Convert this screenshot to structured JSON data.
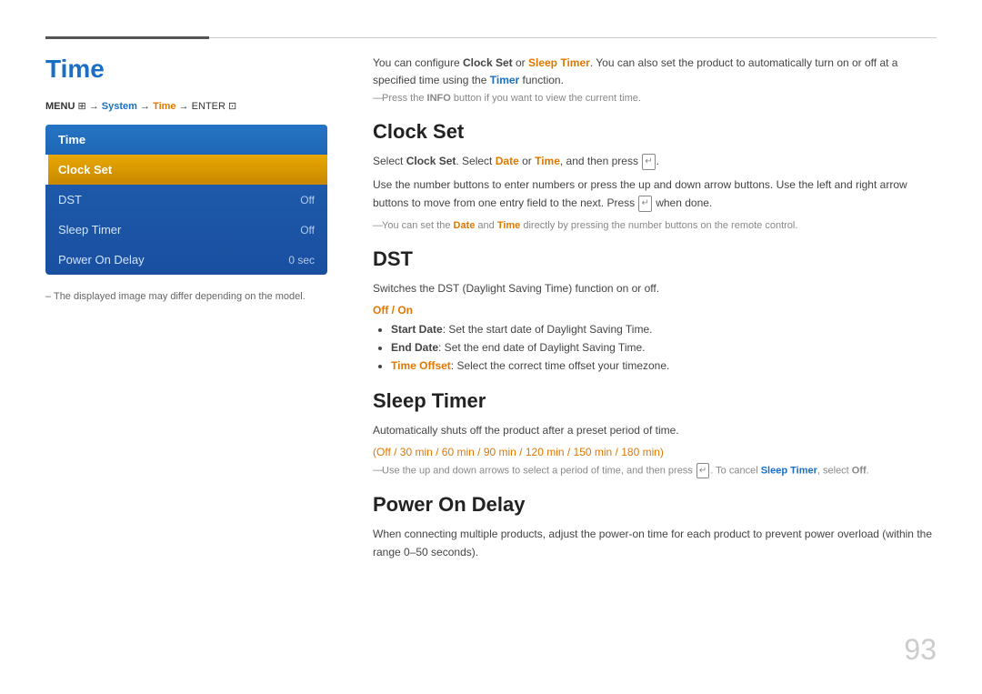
{
  "topbar": {},
  "left": {
    "title": "Time",
    "menu_path_prefix": "MENU",
    "menu_path": "→ System → Time → ENTER",
    "menu_header": "Time",
    "menu_items": [
      {
        "label": "Clock Set",
        "value": "",
        "selected": true
      },
      {
        "label": "DST",
        "value": "Off",
        "selected": false
      },
      {
        "label": "Sleep Timer",
        "value": "Off",
        "selected": false
      },
      {
        "label": "Power On Delay",
        "value": "0 sec",
        "selected": false
      }
    ],
    "note": "–  The displayed image may differ depending on the model."
  },
  "right": {
    "intro_line1_prefix": "You can configure ",
    "intro_clock_set": "Clock Set",
    "intro_line1_mid": " or ",
    "intro_sleep_timer": "Sleep Timer",
    "intro_line1_suffix": ". You can also set the product to automatically turn on or off at a specified time using the ",
    "intro_timer": "Timer",
    "intro_line1_end": " function.",
    "press_note": "Press the INFO button if you want to view the current time.",
    "sections": [
      {
        "id": "clock-set",
        "title": "Clock Set",
        "body_parts": [
          {
            "text": "Select ",
            "style": "normal"
          },
          {
            "text": "Clock Set",
            "style": "bold"
          },
          {
            "text": ". Select ",
            "style": "normal"
          },
          {
            "text": "Date",
            "style": "orange"
          },
          {
            "text": " or ",
            "style": "normal"
          },
          {
            "text": "Time",
            "style": "orange"
          },
          {
            "text": ", and then press ",
            "style": "normal"
          },
          {
            "text": "[E]",
            "style": "enter"
          },
          {
            "text": ".",
            "style": "normal"
          }
        ],
        "body2": "Use the number buttons to enter numbers or press the up and down arrow buttons. Use the left and right arrow buttons to move from one entry field to the next. Press [E] when done.",
        "note": "You can set the Date and Time directly by pressing the number buttons on the remote control.",
        "has_note": true
      },
      {
        "id": "dst",
        "title": "DST",
        "body1": "Switches the DST (Daylight Saving Time) function on or off.",
        "off_on": "Off / On",
        "bullets": [
          {
            "label": "Start Date",
            "text": ": Set the start date of Daylight Saving Time."
          },
          {
            "label": "End Date",
            "text": ": Set the end date of Daylight Saving Time."
          },
          {
            "label": "Time Offset",
            "text": ": Select the correct time offset your timezone."
          }
        ]
      },
      {
        "id": "sleep-timer",
        "title": "Sleep Timer",
        "body1": "Automatically shuts off the product after a preset period of time.",
        "options": "(Off / 30 min / 60 min / 90 min / 120 min / 150 min / 180 min)",
        "note": "Use the up and down arrows to select a period of time, and then press [E]. To cancel Sleep Timer, select Off.",
        "has_note": true
      },
      {
        "id": "power-on-delay",
        "title": "Power On Delay",
        "body1": "When connecting multiple products, adjust the power-on time for each product to prevent power overload (within the range 0–50 seconds)."
      }
    ]
  },
  "page_number": "93"
}
